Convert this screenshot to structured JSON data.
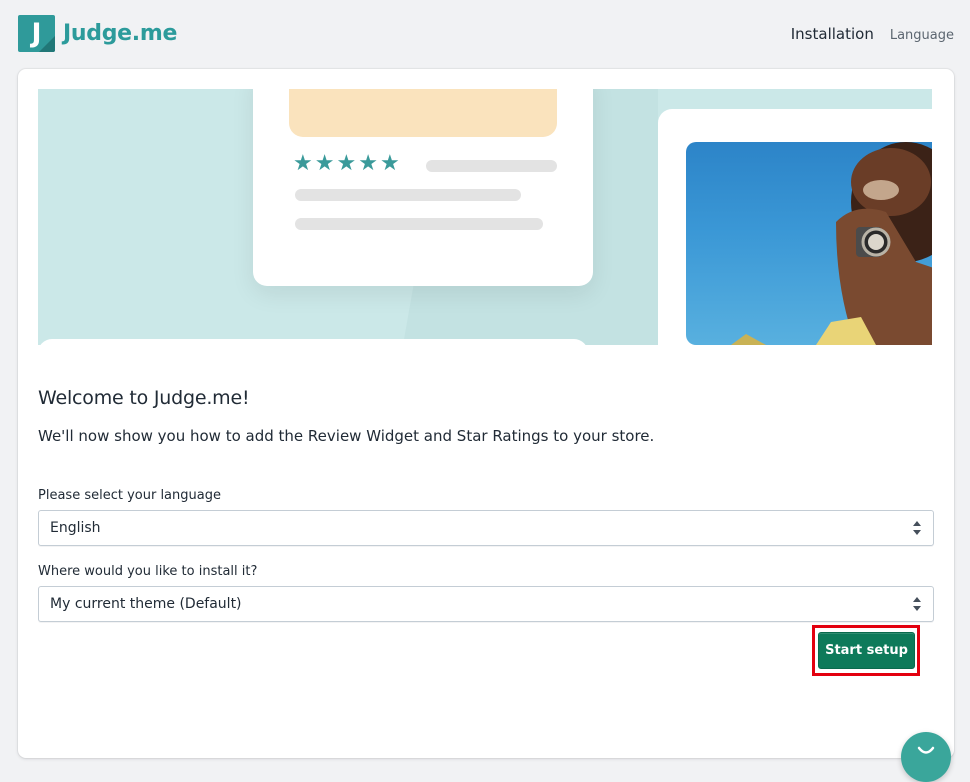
{
  "header": {
    "logo_letter": "J",
    "logo_text": "Judge.me",
    "nav": {
      "active": "Installation",
      "link": "Language"
    }
  },
  "hero": {
    "rating_stars": 5,
    "colors": {
      "teal": "#3a9a9a",
      "background": "#cbe8e8",
      "peach": "#fae3bd"
    }
  },
  "content": {
    "title": "Welcome to Judge.me!",
    "subtitle": "We'll now show you how to add the Review Widget and Star Ratings to your store.",
    "language_label": "Please select your language",
    "language_value": "English",
    "install_label": "Where would you like to install it?",
    "install_value": "My current theme (Default)"
  },
  "actions": {
    "start_label": "Start setup",
    "start_color": "#0e7a5a",
    "highlight_color": "#e3000f"
  },
  "icons": {
    "chat": "chat-icon",
    "select_arrows": "select-arrows-icon",
    "star": "star-icon"
  }
}
